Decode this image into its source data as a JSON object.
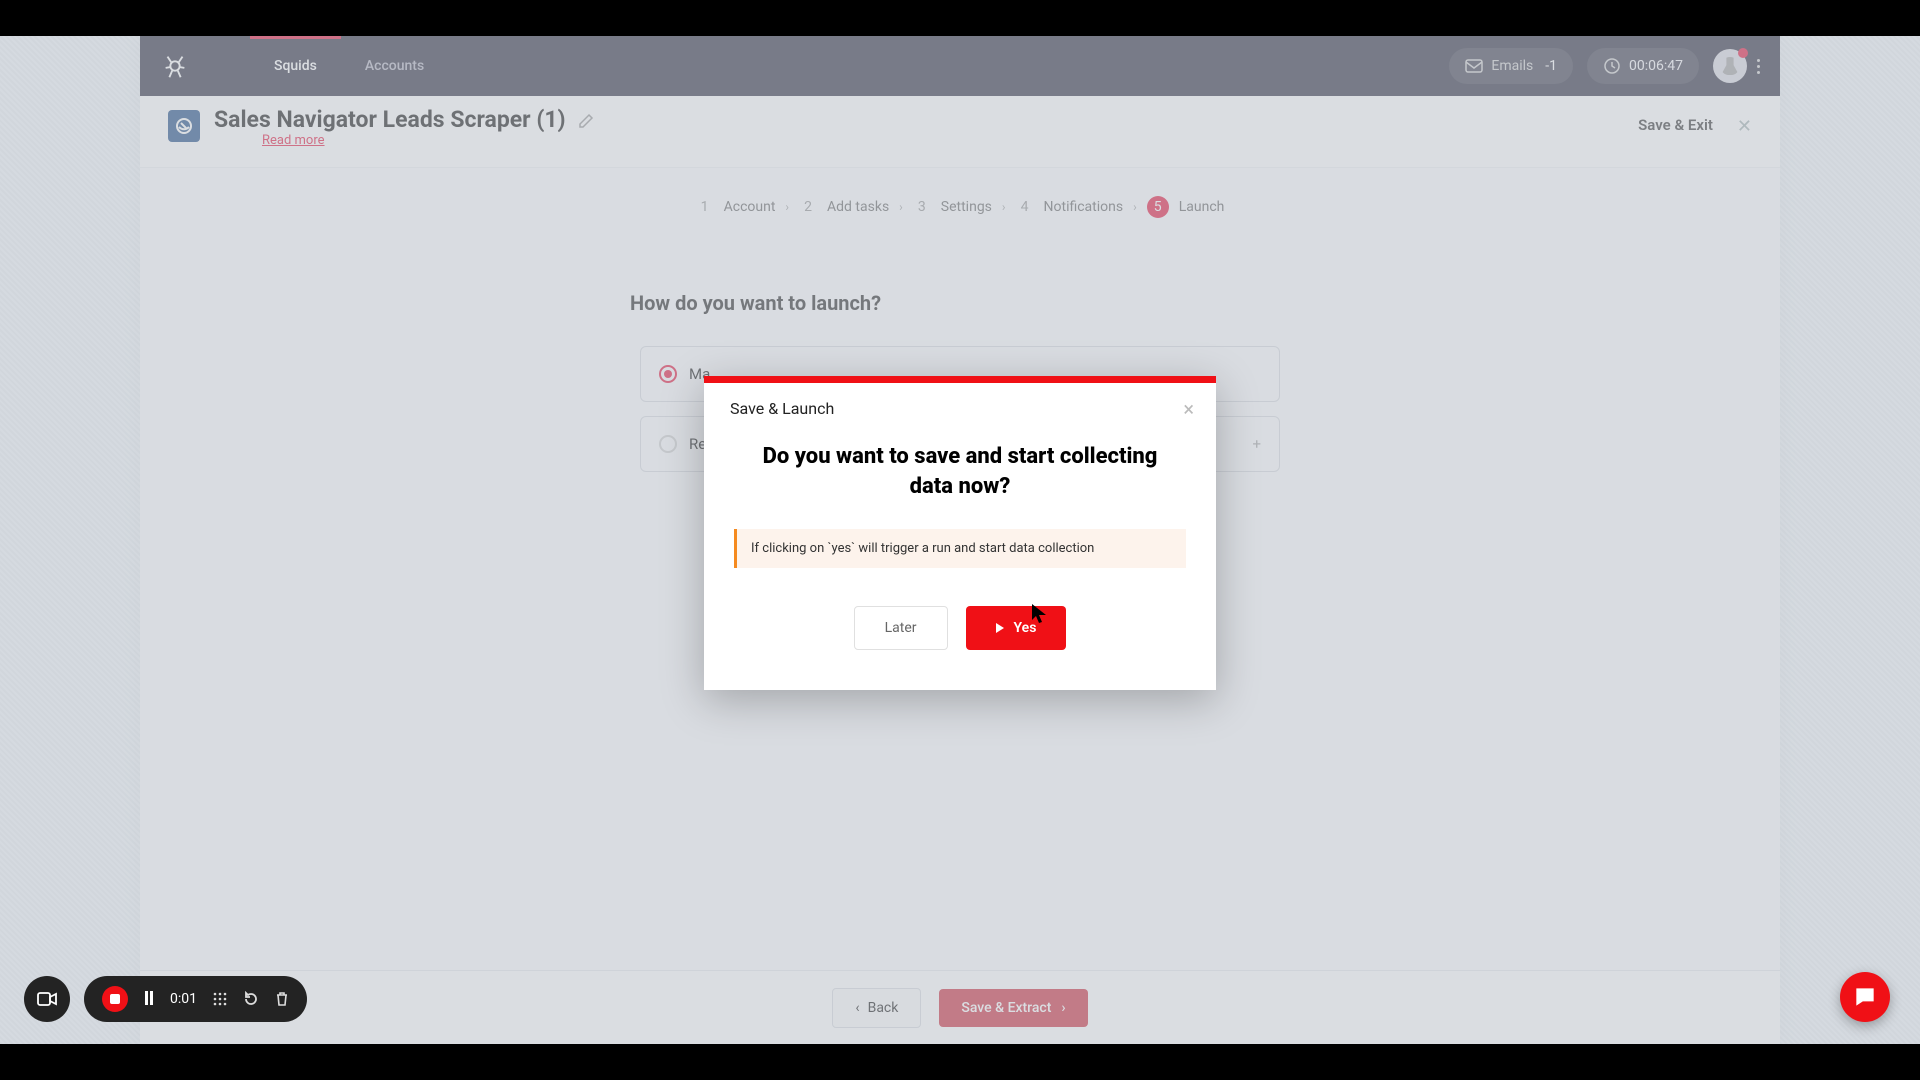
{
  "topnav": {
    "tabs": [
      "Squids",
      "Accounts"
    ],
    "emails_label": "Emails",
    "emails_count": "-1",
    "timer": "00:06:47"
  },
  "header": {
    "title": "Sales Navigator Leads Scraper (1)",
    "readmore": "Read more",
    "save_exit": "Save & Exit"
  },
  "stepper": {
    "steps": [
      {
        "n": "1",
        "label": "Account"
      },
      {
        "n": "2",
        "label": "Add tasks"
      },
      {
        "n": "3",
        "label": "Settings"
      },
      {
        "n": "4",
        "label": "Notifications"
      },
      {
        "n": "5",
        "label": "Launch"
      }
    ]
  },
  "main": {
    "question": "How do you want to launch?",
    "opt1_prefix": "Ma",
    "opt2_prefix": "Re"
  },
  "bottombar": {
    "back": "Back",
    "save_extract": "Save & Extract"
  },
  "modal": {
    "head": "Save & Launch",
    "title": "Do you want to save and start collecting data now?",
    "note": "If clicking on `yes` will trigger a run and start data collection",
    "later": "Later",
    "yes": "Yes"
  },
  "recorder": {
    "time": "0:01"
  }
}
